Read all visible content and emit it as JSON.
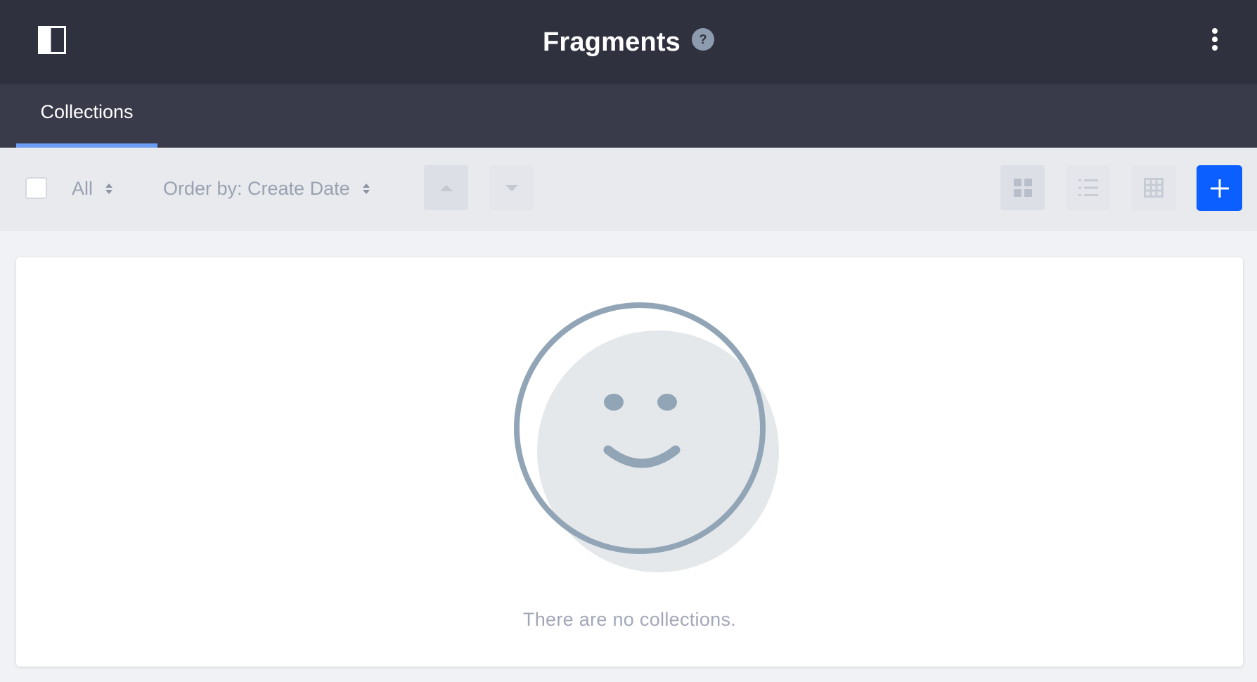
{
  "header": {
    "title": "Fragments",
    "help_label": "?",
    "sidebar_toggle_icon": "sidebar-toggle-icon",
    "menu_icon": "kebab-icon"
  },
  "nav": {
    "tabs": [
      {
        "label": "Collections",
        "active": true
      }
    ],
    "active_color": "#6d9cf5"
  },
  "toolbar": {
    "filter_label": "All",
    "order_label": "Order by: Create Date",
    "sort_asc_icon": "caret-up-icon",
    "sort_desc_icon": "caret-down-icon",
    "views": [
      "cards",
      "list",
      "table"
    ],
    "active_view": "cards",
    "add_icon": "plus-icon",
    "add_color": "#0b5fff"
  },
  "empty_state": {
    "icon": "smiley-face-icon",
    "message": "There are no collections."
  },
  "colors": {
    "header_bg": "#30313f",
    "nav_bg": "#393a4a",
    "toolbar_bg": "#e8eaee",
    "illustration_stroke": "#91a5b6",
    "illustration_fill": "#e5e8ea"
  }
}
